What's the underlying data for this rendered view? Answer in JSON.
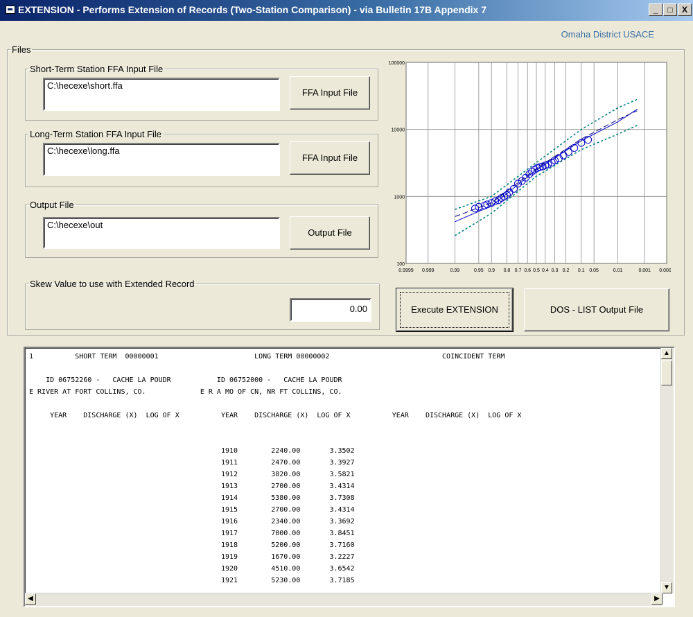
{
  "window": {
    "title": "EXTENSION - Performs Extension of Records (Two-Station Comparison) - via Bulletin 17B Appendix 7",
    "subtitle": "Omaha District USACE",
    "controls": {
      "minimize": "_",
      "maximize": "□",
      "close": "X"
    }
  },
  "files_group": {
    "label": "Files",
    "short_term": {
      "label": "Short-Term Station FFA Input File",
      "value": "C:\\hecexe\\short.ffa",
      "button": "FFA Input File"
    },
    "long_term": {
      "label": "Long-Term Station FFA Input File",
      "value": "C:\\hecexe\\long.ffa",
      "button": "FFA Input File"
    },
    "output": {
      "label": "Output File",
      "value": "C:\\hecexe\\out",
      "button": "Output File"
    }
  },
  "skew": {
    "label": "Skew Value to use with Extended Record",
    "value": "0.00"
  },
  "buttons": {
    "execute": "Execute EXTENSION",
    "dos_list": "DOS - LIST Output File"
  },
  "chart_data": {
    "type": "scatter",
    "y_scale": "log",
    "ylim": [
      100,
      100000
    ],
    "y_tick_labels": [
      "100000",
      "10000",
      "1000",
      "100"
    ],
    "x_tick_labels": [
      "0.9999",
      "0.999",
      "0.99",
      "0.95",
      "0.9",
      "0.8",
      "0.7",
      "0.6",
      "0.5",
      "0.4",
      "0.3",
      "0.2",
      "0.1",
      "0.05",
      "0.01",
      "0.001",
      "0.0001"
    ],
    "grid": true,
    "series": [
      {
        "style": "points",
        "color": "#0000cc",
        "points": [
          [
            0.96,
            660
          ],
          [
            0.95,
            700
          ],
          [
            0.93,
            730
          ],
          [
            0.92,
            760
          ],
          [
            0.9,
            800
          ],
          [
            0.88,
            850
          ],
          [
            0.86,
            880
          ],
          [
            0.84,
            950
          ],
          [
            0.82,
            1000
          ],
          [
            0.8,
            1050
          ],
          [
            0.78,
            1150
          ],
          [
            0.74,
            1300
          ],
          [
            0.7,
            1550
          ],
          [
            0.66,
            1700
          ],
          [
            0.62,
            1900
          ],
          [
            0.58,
            2150
          ],
          [
            0.55,
            2350
          ],
          [
            0.52,
            2500
          ],
          [
            0.49,
            2650
          ],
          [
            0.46,
            2750
          ],
          [
            0.43,
            2800
          ],
          [
            0.4,
            2900
          ],
          [
            0.37,
            3000
          ],
          [
            0.33,
            3200
          ],
          [
            0.3,
            3450
          ],
          [
            0.26,
            3700
          ],
          [
            0.22,
            4100
          ],
          [
            0.18,
            4600
          ],
          [
            0.14,
            5300
          ],
          [
            0.1,
            6300
          ],
          [
            0.07,
            7000
          ]
        ]
      },
      {
        "style": "line",
        "color": "#0000cc",
        "points": [
          [
            0.99,
            420
          ],
          [
            0.9,
            720
          ],
          [
            0.5,
            2500
          ],
          [
            0.1,
            6800
          ],
          [
            0.01,
            13000
          ],
          [
            0.002,
            20000
          ]
        ]
      },
      {
        "style": "dashed",
        "color": "#000080",
        "points": [
          [
            0.99,
            500
          ],
          [
            0.9,
            800
          ],
          [
            0.5,
            2600
          ],
          [
            0.1,
            7200
          ],
          [
            0.01,
            14000
          ],
          [
            0.002,
            19000
          ]
        ]
      },
      {
        "style": "dotted",
        "color": "#008080",
        "points": [
          [
            0.99,
            640
          ],
          [
            0.9,
            1000
          ],
          [
            0.5,
            3200
          ],
          [
            0.1,
            10000
          ],
          [
            0.01,
            21000
          ],
          [
            0.002,
            28000
          ]
        ]
      },
      {
        "style": "dotted",
        "color": "#008080",
        "points": [
          [
            0.99,
            260
          ],
          [
            0.9,
            560
          ],
          [
            0.5,
            2000
          ],
          [
            0.1,
            5000
          ],
          [
            0.01,
            8500
          ],
          [
            0.002,
            11500
          ]
        ]
      }
    ]
  },
  "listing": {
    "lines": [
      "1          SHORT TERM  00000001                       LONG TERM 00000002                           COINCIDENT TERM",
      "",
      "    ID 06752260 -   CACHE LA POUDR           ID 06752000 -   CACHE LA POUDR",
      "E RIVER AT FORT COLLINS, CO.             E R A MO OF CN, NR FT COLLINS, CO.",
      "",
      "     YEAR    DISCHARGE (X)  LOG OF X          YEAR    DISCHARGE (X)  LOG OF X          YEAR    DISCHARGE (X)  LOG OF X",
      "",
      "",
      "                                              1910        2240.00       3.3502",
      "                                              1911        2470.00       3.3927",
      "                                              1912        3820.00       3.5821",
      "                                              1913        2700.00       3.4314",
      "                                              1914        5380.00       3.7308",
      "                                              1915        2700.00       3.4314",
      "                                              1916        2340.00       3.3692",
      "                                              1917        7000.00       3.8451",
      "                                              1918        5200.00       3.7160",
      "                                              1919        1670.00       3.2227",
      "                                              1920        4510.00       3.6542",
      "                                              1921        5230.00       3.7185"
    ],
    "scroll": {
      "up": "▲",
      "down": "▼",
      "left": "◀",
      "right": "▶"
    }
  }
}
